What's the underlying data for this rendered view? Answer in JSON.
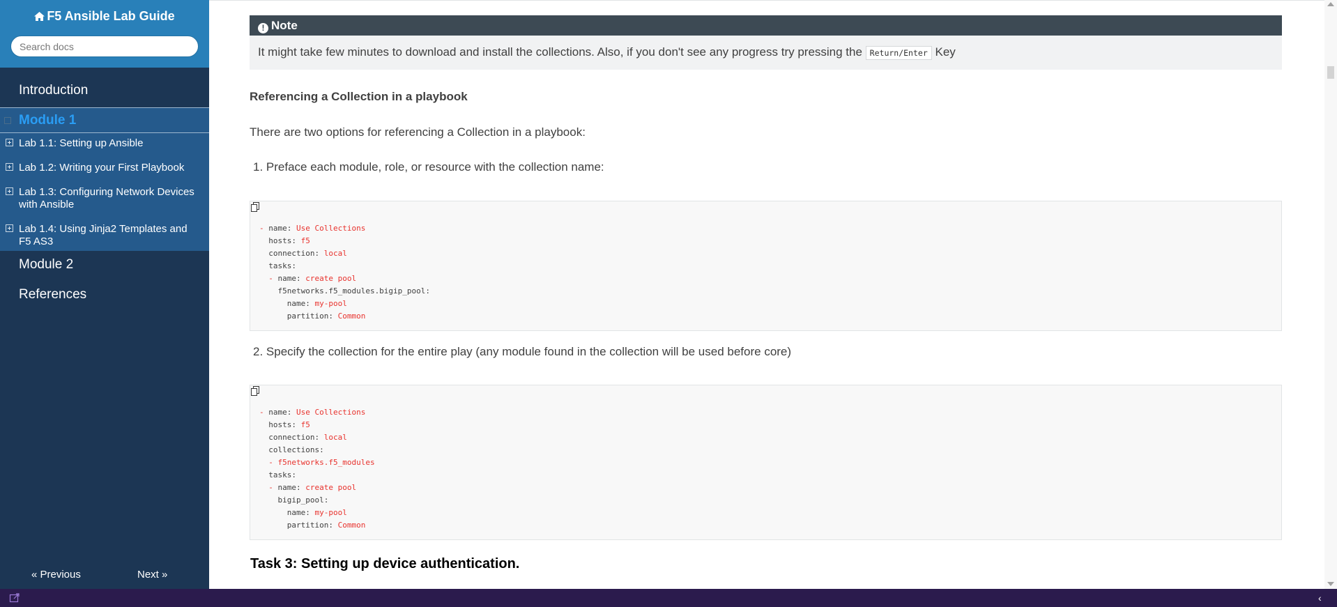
{
  "sidebar": {
    "title": "F5 Ansible Lab Guide",
    "search_placeholder": "Search docs",
    "nav": {
      "introduction": "Introduction",
      "module1": "Module 1",
      "labs": [
        "Lab 1.1: Setting up Ansible",
        "Lab 1.2: Writing your First Playbook",
        "Lab 1.3: Configuring Network Devices with Ansible",
        "Lab 1.4: Using Jinja2 Templates and F5 AS3"
      ],
      "module2": "Module 2",
      "references": "References"
    },
    "prev_label": "« Previous",
    "next_label": "Next »"
  },
  "note": {
    "title": "Note",
    "text_before": "It might take few minutes to download and install the collections. Also, if you don't see any progress try pressing the",
    "key": "Return/Enter",
    "text_after": "Key"
  },
  "content": {
    "subheading": "Referencing a Collection in a playbook",
    "intro": "There are two options for referencing a Collection in a playbook:",
    "option1": "1. Preface each module, role, or resource with the collection name:",
    "option2": "2. Specify the collection for the entire play (any module found in the collection will be used before core)",
    "task_heading": "Task 3: Setting up device authentication."
  },
  "code1": {
    "l1a": "- ",
    "l1b": "name: ",
    "l1c": "Use Collections",
    "l2a": "  hosts: ",
    "l2b": "f5",
    "l3a": "  connection: ",
    "l3b": "local",
    "l4a": "  tasks:",
    "l5a": "  - ",
    "l5b": "name: ",
    "l5c": "create pool",
    "l6a": "    f5networks.f5_modules.bigip_pool:",
    "l7a": "      name: ",
    "l7b": "my-pool",
    "l8a": "      partition: ",
    "l8b": "Common"
  },
  "code2": {
    "l1a": "- ",
    "l1b": "name: ",
    "l1c": "Use Collections",
    "l2a": "  hosts: ",
    "l2b": "f5",
    "l3a": "  connection: ",
    "l3b": "local",
    "l4a": "  collections:",
    "l5a": "  - ",
    "l5b": "f5networks.f5_modules",
    "l6a": "  tasks:",
    "l7a": "  - ",
    "l7b": "name: ",
    "l7c": "create pool",
    "l8a": "    bigip_pool:",
    "l9a": "      name: ",
    "l9b": "my-pool",
    "l10a": "      partition: ",
    "l10b": "Common"
  },
  "icons": {
    "home": "home-icon",
    "info": "info-circle-icon",
    "copy": "copy-icon",
    "external": "external-link-icon"
  },
  "colors": {
    "sidebar_bg": "#1c3654",
    "sidebar_header": "#2980b9",
    "active_module": "#2a9df4",
    "code_string": "#e8322d",
    "note_header": "#3d4a54"
  }
}
